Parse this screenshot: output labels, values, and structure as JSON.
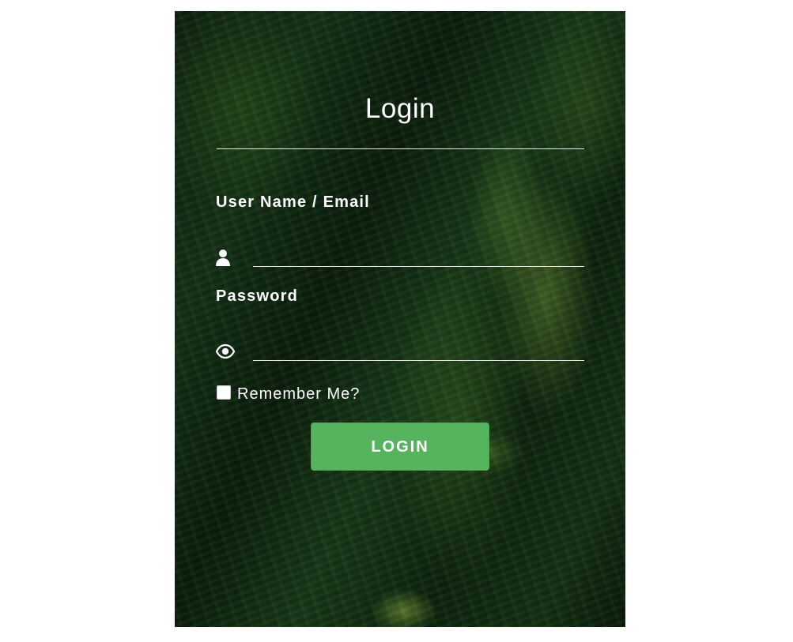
{
  "form": {
    "title": "Login",
    "username": {
      "label": "User Name / Email",
      "icon": "user-icon",
      "value": "",
      "placeholder": ""
    },
    "password": {
      "label": "Password",
      "icon": "eye-icon",
      "value": "",
      "placeholder": ""
    },
    "remember": {
      "label": "Remember Me?",
      "checked": false
    },
    "submit_label": "LOGIN"
  },
  "colors": {
    "button": "#55b45d",
    "text": "#ffffff"
  }
}
